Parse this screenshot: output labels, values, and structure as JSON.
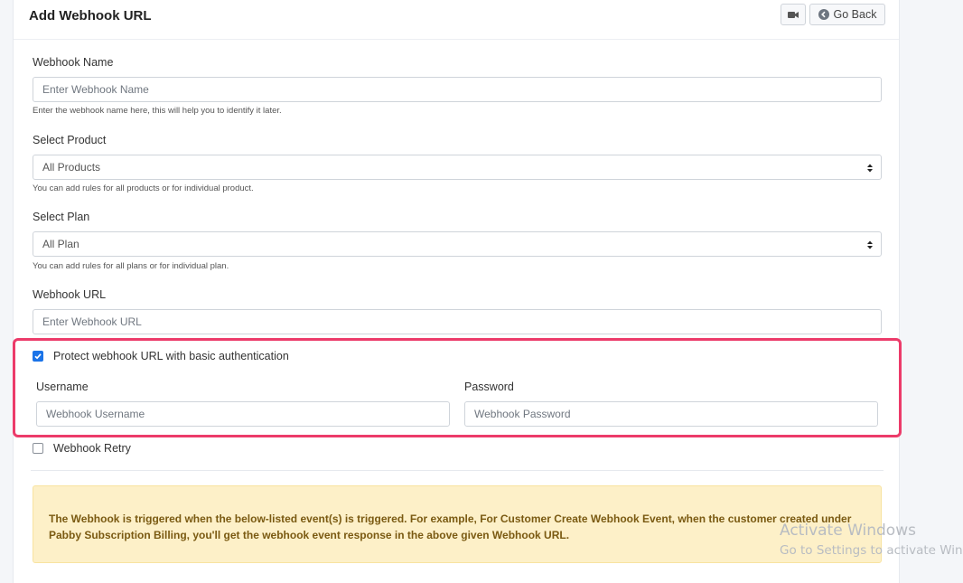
{
  "header": {
    "title": "Add Webhook URL",
    "go_back_label": "Go Back"
  },
  "form": {
    "webhook_name": {
      "label": "Webhook Name",
      "placeholder": "Enter Webhook Name",
      "help": "Enter the webhook name here, this will help you to identify it later."
    },
    "select_product": {
      "label": "Select Product",
      "selected": "All Products",
      "help": "You can add rules for all products or for individual product."
    },
    "select_plan": {
      "label": "Select Plan",
      "selected": "All Plan",
      "help": "You can add rules for all plans or for individual plan."
    },
    "webhook_url": {
      "label": "Webhook URL",
      "placeholder": "Enter Webhook URL"
    },
    "basic_auth": {
      "label": "Protect webhook URL with basic authentication",
      "checked": true,
      "username_label": "Username",
      "username_placeholder": "Webhook Username",
      "password_label": "Password",
      "password_placeholder": "Webhook Password"
    },
    "retry": {
      "label": "Webhook Retry",
      "checked": false
    }
  },
  "alert": {
    "text": "The Webhook is triggered when the below-listed event(s) is triggered. For example, For Customer Create Webhook Event, when the customer created under Pabby Subscription Billing, you'll get the webhook event response in the above given Webhook URL."
  },
  "watermark": {
    "line1": "Activate Windows",
    "line2": "Go to Settings to activate Windows."
  },
  "colors": {
    "highlight": "#ec3b6a",
    "checkbox_accent": "#1a73e8",
    "alert_bg": "#fdf0c8"
  }
}
